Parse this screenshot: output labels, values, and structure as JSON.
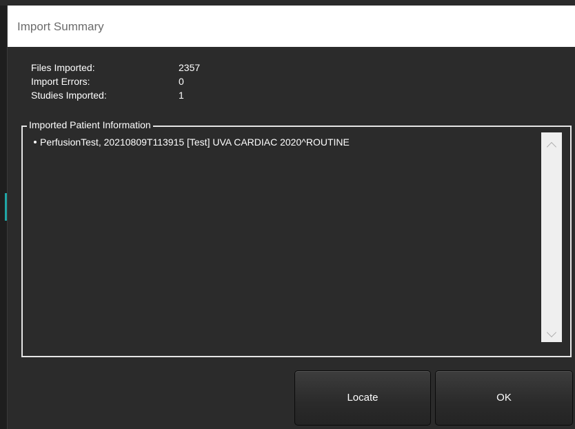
{
  "dialog": {
    "title": "Import Summary"
  },
  "stats": [
    {
      "label": "Files Imported:",
      "value": "2357"
    },
    {
      "label": "Import Errors:",
      "value": "0"
    },
    {
      "label": "Studies Imported:",
      "value": "1"
    }
  ],
  "patient_info": {
    "group_label": "Imported Patient Information",
    "items": [
      "PerfusionTest, 20210809T113915 [Test] UVA CARDIAC 2020^ROUTINE"
    ]
  },
  "buttons": {
    "locate": "Locate",
    "ok": "OK"
  },
  "colors": {
    "dialog_bg": "#2b2b2b",
    "titlebar_bg": "#ffffff",
    "accent_teal": "#1fa6a6"
  },
  "icons": {
    "scroll_up": "chevron-up-icon",
    "scroll_down": "chevron-down-icon"
  }
}
